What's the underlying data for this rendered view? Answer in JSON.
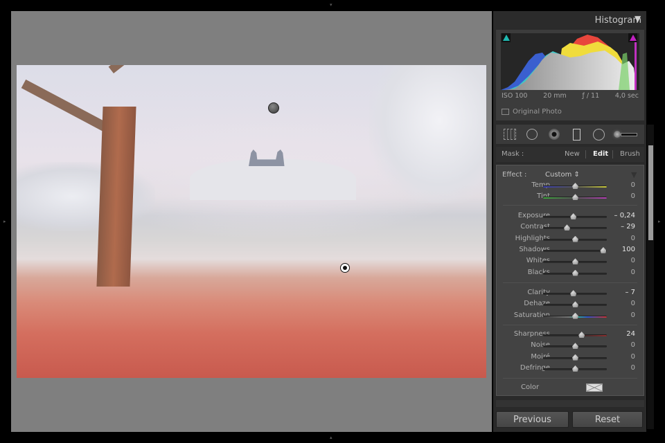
{
  "workspace": {
    "background_color": "#7f7f7f",
    "edge_arrows": {
      "top": "▾",
      "bottom": "▴",
      "left": "▸",
      "right": "▸"
    },
    "photo": {
      "description": "Frosty orchard with castle on hill; red mask overlay on foreground grass with fallen apples",
      "mask_overlay_color": "#d9554a"
    },
    "pins": [
      {
        "name": "inactive-mask-pin",
        "state": "inactive"
      },
      {
        "name": "active-mask-pin",
        "state": "active"
      }
    ]
  },
  "histogram": {
    "title": "Histogram",
    "toggle_icon": "▼",
    "clip_shadow_icon": "shadow-clipping-indicator",
    "clip_highlight_icon": "highlight-clipping-indicator",
    "iso": "ISO 100",
    "focal_length": "20 mm",
    "aperture": "ƒ / 11",
    "shutter": "4,0 sec",
    "original_photo_label": "Original Photo",
    "colors": {
      "shadow_clip": "#1fb8b0",
      "highlight_clip": "#c020c0"
    }
  },
  "tools": [
    {
      "name": "crop-overlay-tool",
      "glyph": "⬚"
    },
    {
      "name": "spot-removal-tool",
      "glyph": "○"
    },
    {
      "name": "red-eye-tool",
      "glyph": "◉"
    },
    {
      "name": "graduated-filter-tool",
      "glyph": "▯"
    },
    {
      "name": "radial-filter-tool",
      "glyph": "○"
    },
    {
      "name": "adjustment-brush-tool",
      "glyph": "⊸"
    }
  ],
  "mask": {
    "label": "Mask :",
    "new": "New",
    "edit": "Edit",
    "brush": "Brush"
  },
  "effect": {
    "label": "Effect :",
    "value": "Custom ⇕",
    "toggle_icon": "▼"
  },
  "sliders": [
    {
      "group": 1,
      "label": "Temp",
      "value": "0",
      "position": 0.5,
      "track": "temp"
    },
    {
      "group": 1,
      "label": "Tint",
      "value": "0",
      "position": 0.5,
      "track": "tint"
    },
    {
      "group": 2,
      "label": "Exposure",
      "value": "– 0,24",
      "position": 0.47,
      "set": true
    },
    {
      "group": 2,
      "label": "Contrast",
      "value": "– 29",
      "position": 0.37,
      "set": true
    },
    {
      "group": 2,
      "label": "Highlights",
      "value": "0",
      "position": 0.5
    },
    {
      "group": 2,
      "label": "Shadows",
      "value": "100",
      "position": 0.94,
      "set": true
    },
    {
      "group": 2,
      "label": "Whites",
      "value": "0",
      "position": 0.5
    },
    {
      "group": 2,
      "label": "Blacks",
      "value": "0",
      "position": 0.5
    },
    {
      "group": 3,
      "label": "Clarity",
      "value": "– 7",
      "position": 0.47,
      "set": true
    },
    {
      "group": 3,
      "label": "Dehaze",
      "value": "0",
      "position": 0.5
    },
    {
      "group": 3,
      "label": "Saturation",
      "value": "0",
      "position": 0.5,
      "track": "saturation"
    },
    {
      "group": 4,
      "label": "Sharpness",
      "value": "24",
      "position": 0.6,
      "set": true,
      "track": "sharpness"
    },
    {
      "group": 4,
      "label": "Noise",
      "value": "0",
      "position": 0.5
    },
    {
      "group": 4,
      "label": "Moiré",
      "value": "0",
      "position": 0.5
    },
    {
      "group": 4,
      "label": "Defringe",
      "value": "0",
      "position": 0.5
    }
  ],
  "color": {
    "label": "Color",
    "swatch": "none"
  },
  "buttons": {
    "previous": "Previous",
    "reset": "Reset"
  }
}
